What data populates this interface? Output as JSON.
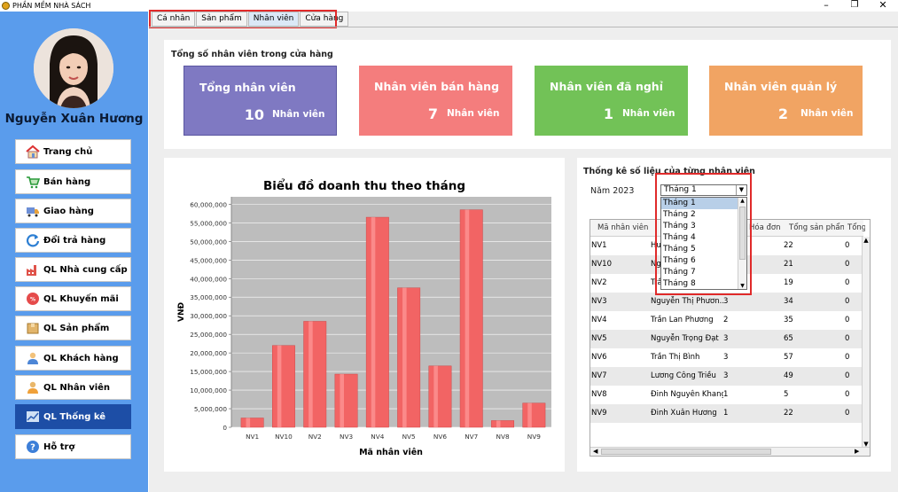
{
  "window": {
    "title": "PHẦN MỀM NHÀ SÁCH",
    "minimize": "–",
    "maximize": "❐",
    "close": "✕"
  },
  "sidebar": {
    "user_name": "Nguyễn Xuân Hương",
    "items": [
      {
        "label": "Trang chủ",
        "icon": "home-icon"
      },
      {
        "label": "Bán hàng",
        "icon": "cart-icon"
      },
      {
        "label": "Giao hàng",
        "icon": "truck-icon"
      },
      {
        "label": "Đổi trả hàng",
        "icon": "refresh-icon"
      },
      {
        "label": "QL Nhà cung cấp",
        "icon": "factory-icon"
      },
      {
        "label": "QL Khuyến mãi",
        "icon": "sale-icon"
      },
      {
        "label": "QL Sản phẩm",
        "icon": "box-icon"
      },
      {
        "label": "QL Khách hàng",
        "icon": "customer-icon"
      },
      {
        "label": "QL Nhân viên",
        "icon": "employee-icon"
      },
      {
        "label": "QL Thống kê",
        "icon": "chart-icon"
      },
      {
        "label": "Hỗ trợ",
        "icon": "help-icon"
      }
    ]
  },
  "tabs": [
    "Cá nhân",
    "Sản phẩm",
    "Nhân viên",
    "Cửa hàng"
  ],
  "summary": {
    "title": "Tổng số nhân viên trong cửa hàng",
    "cards": [
      {
        "title": "Tổng nhân viên",
        "value": "10",
        "unit": "Nhân viên",
        "color": "#7f79c2"
      },
      {
        "title": "Nhân viên bán hàng",
        "value": "7",
        "unit": "Nhân viên",
        "color": "#f47d7d"
      },
      {
        "title": "Nhân viên đã nghỉ",
        "value": "1",
        "unit": "Nhân viên",
        "color": "#72c257"
      },
      {
        "title": "Nhân viên quản lý",
        "value": "2",
        "unit": "Nhân viên",
        "color": "#f1a463"
      }
    ]
  },
  "chart_data": {
    "type": "bar",
    "title": "Biểu đồ doanh thu theo tháng",
    "xlabel": "Mã nhân viên",
    "ylabel": "VNĐ",
    "categories": [
      "NV1",
      "NV10",
      "NV2",
      "NV3",
      "NV4",
      "NV5",
      "NV6",
      "NV7",
      "NV8",
      "NV9"
    ],
    "values": [
      2500000,
      22000000,
      28500000,
      14300000,
      56500000,
      37500000,
      16500000,
      58500000,
      1800000,
      6500000
    ],
    "ylim": [
      0,
      62000000
    ],
    "yticks": [
      "0",
      "5,000,000",
      "10,000,000",
      "15,000,000",
      "20,000,000",
      "25,000,000",
      "30,000,000",
      "35,000,000",
      "40,000,000",
      "45,000,000",
      "50,000,000",
      "55,000,000",
      "60,000,000"
    ],
    "bar_color": "#f26464",
    "plot_bg": "#bdbdbd"
  },
  "stats": {
    "title": "Thống kê số liệu của từng nhân viên",
    "year_label": "Năm 2023",
    "selected_month": "Tháng 1",
    "months": [
      "Tháng 1",
      "Tháng 2",
      "Tháng 3",
      "Tháng 4",
      "Tháng 5",
      "Tháng 6",
      "Tháng 7",
      "Tháng 8"
    ],
    "columns": [
      "Mã nhân viên",
      "Hóa đơn",
      "Tổng sản phẩm",
      "Tổng"
    ],
    "rows": [
      {
        "id": "NV1",
        "name": "Hu",
        "orders": "",
        "products": "22",
        "total": "0"
      },
      {
        "id": "NV10",
        "name": "Ng",
        "orders": "",
        "products": "21",
        "total": "0"
      },
      {
        "id": "NV2",
        "name": "Trầ",
        "orders": "",
        "products": "19",
        "total": "0"
      },
      {
        "id": "NV3",
        "name": "Nguyễn Thị Phươn...",
        "orders": "3",
        "products": "34",
        "total": "0"
      },
      {
        "id": "NV4",
        "name": "Trần Lan Phương",
        "orders": "2",
        "products": "35",
        "total": "0"
      },
      {
        "id": "NV5",
        "name": "Nguyễn Trọng Đạt",
        "orders": "3",
        "products": "65",
        "total": "0"
      },
      {
        "id": "NV6",
        "name": "Trần Thị Bình",
        "orders": "3",
        "products": "57",
        "total": "0"
      },
      {
        "id": "NV7",
        "name": "Lương Công Triều",
        "orders": "3",
        "products": "49",
        "total": "0"
      },
      {
        "id": "NV8",
        "name": "Đinh Nguyên Khang",
        "orders": "1",
        "products": "5",
        "total": "0"
      },
      {
        "id": "NV9",
        "name": "Đinh Xuân Hương",
        "orders": "1",
        "products": "22",
        "total": "0"
      }
    ]
  }
}
